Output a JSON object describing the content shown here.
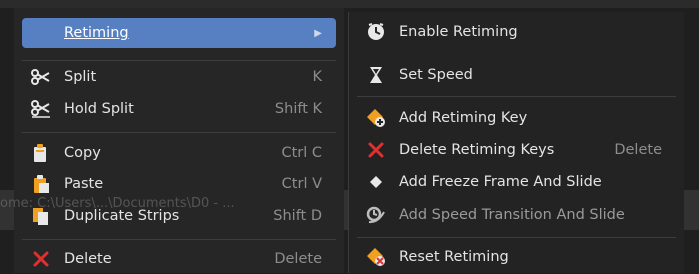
{
  "left_menu": {
    "items": [
      {
        "label": "Retiming",
        "mnemonic": "R",
        "shortcut": "",
        "icon": "",
        "submenu": true,
        "highlight": true
      },
      {
        "label": "Split",
        "mnemonic": "S",
        "shortcut": "K",
        "icon": "scissors-icon"
      },
      {
        "label": "Hold Split",
        "mnemonic": "H",
        "shortcut": "Shift K",
        "icon": "hold-scissors-icon"
      },
      {
        "label": "Copy",
        "mnemonic": "C",
        "shortcut": "Ctrl C",
        "icon": "copy-icon"
      },
      {
        "label": "Paste",
        "mnemonic": "P",
        "shortcut": "Ctrl V",
        "icon": "paste-icon"
      },
      {
        "label": "Duplicate Strips",
        "mnemonic": "D",
        "shortcut": "Shift D",
        "icon": "duplicate-icon"
      },
      {
        "label": "Delete",
        "mnemonic": "e",
        "shortcut": "Delete",
        "icon": "delete-x-icon"
      }
    ],
    "submenu_arrow": "▶"
  },
  "right_menu": {
    "items": [
      {
        "label": "Enable Retiming",
        "mnemonic": "E",
        "shortcut": "",
        "icon": "clock-icon"
      },
      {
        "label": "Set Speed",
        "mnemonic": "S",
        "shortcut": "",
        "icon": "speed-icon"
      },
      {
        "label": "Add Retiming Key",
        "mnemonic": "A",
        "shortcut": "",
        "icon": "add-key-icon"
      },
      {
        "label": "Delete Retiming Keys",
        "mnemonic": "D",
        "shortcut": "Delete",
        "icon": "delete-x-icon"
      },
      {
        "label": "Add Freeze Frame And Slide",
        "mnemonic": "F",
        "shortcut": "",
        "icon": "diamond-icon"
      },
      {
        "label": "Add Speed Transition And Slide",
        "mnemonic": "T",
        "shortcut": "",
        "icon": "speed-transition-icon",
        "disabled": true
      },
      {
        "label": "Reset Retiming",
        "mnemonic": "R",
        "shortcut": "",
        "icon": "reset-key-icon"
      }
    ]
  },
  "watermark": "ome: C:\\Users\\...\\Documents\\D0 - ...",
  "colors": {
    "highlight": "#5680c2",
    "accent_orange": "#f0a020",
    "delete_red": "#e03030"
  }
}
